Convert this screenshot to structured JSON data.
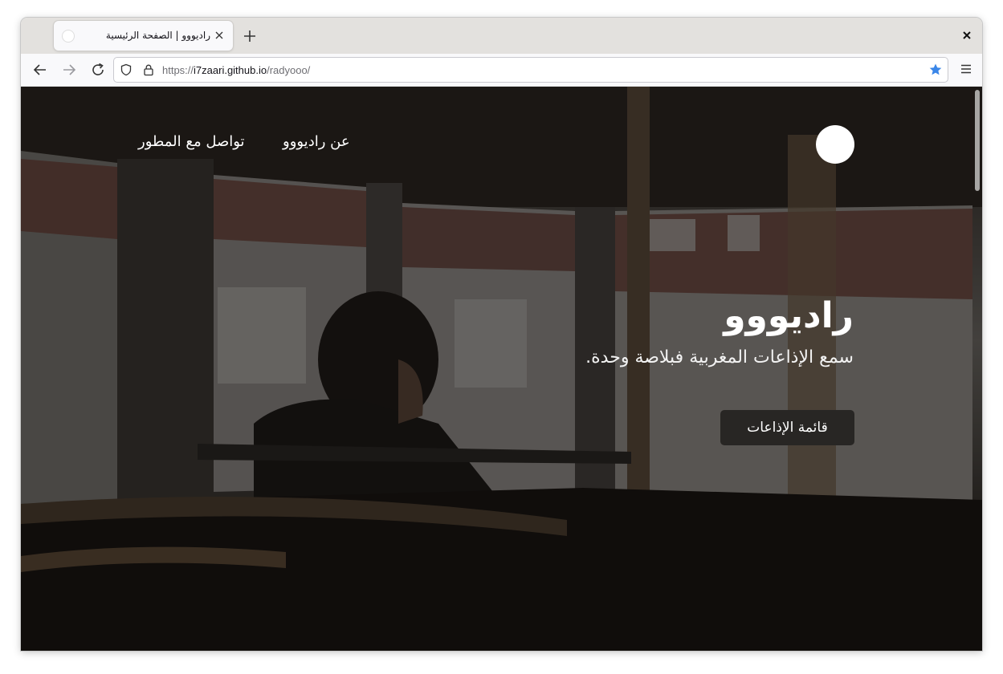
{
  "browser": {
    "tab": {
      "title": "راديووو | الصفحة الرئيسية",
      "close_icon": "close-icon"
    },
    "new_tab_icon": "plus-icon",
    "window_close_icon": "close-icon",
    "toolbar": {
      "back_icon": "arrow-left-icon",
      "forward_icon": "arrow-right-icon",
      "reload_icon": "reload-icon",
      "shield_icon": "shield-icon",
      "lock_icon": "lock-icon",
      "bookmark_icon": "star-icon",
      "menu_icon": "hamburger-menu-icon",
      "bookmark_color": "#3a86e8"
    },
    "url": {
      "scheme": "https://",
      "host": "i7zaari.github.io",
      "path": "/radyooo/"
    }
  },
  "page": {
    "nav": {
      "about": "عن راديووو",
      "contact": "تواصل مع المطور"
    },
    "hero": {
      "title": "راديووو",
      "subtitle": "سمع الإذاعات المغربية فبلاصة وحدة.",
      "button": "قائمة الإذاعات"
    },
    "colors": {
      "button_bg": "#282624",
      "text": "#ffffff"
    }
  }
}
